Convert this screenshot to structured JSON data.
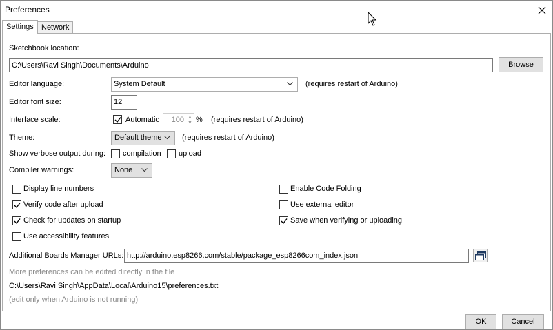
{
  "window": {
    "title": "Preferences"
  },
  "tabs": [
    {
      "label": "Settings"
    },
    {
      "label": "Network"
    }
  ],
  "sketchbook": {
    "label": "Sketchbook location:",
    "value": "C:\\Users\\Ravi Singh\\Documents\\Arduino",
    "browse_label": "Browse"
  },
  "editor_language": {
    "label": "Editor language:",
    "value": "System Default",
    "note": "(requires restart of Arduino)"
  },
  "editor_font_size": {
    "label": "Editor font size:",
    "value": "12"
  },
  "interface_scale": {
    "label": "Interface scale:",
    "automatic_label": "Automatic",
    "automatic_checked": true,
    "value": "100",
    "unit": "%",
    "note": "(requires restart of Arduino)"
  },
  "theme": {
    "label": "Theme:",
    "value": "Default theme",
    "note": "(requires restart of Arduino)"
  },
  "verbose": {
    "label": "Show verbose output during:",
    "compilation_label": "compilation",
    "compilation_checked": false,
    "upload_label": "upload",
    "upload_checked": false
  },
  "compiler_warnings": {
    "label": "Compiler warnings:",
    "value": "None"
  },
  "options": {
    "display_line_numbers": {
      "label": "Display line numbers",
      "checked": false
    },
    "verify_after_upload": {
      "label": "Verify code after upload",
      "checked": true
    },
    "check_updates": {
      "label": "Check for updates on startup",
      "checked": true
    },
    "accessibility": {
      "label": "Use accessibility features",
      "checked": false
    },
    "code_folding": {
      "label": "Enable Code Folding",
      "checked": false
    },
    "external_editor": {
      "label": "Use external editor",
      "checked": false
    },
    "save_when_verifying": {
      "label": "Save when verifying or uploading",
      "checked": true
    }
  },
  "boards_manager": {
    "label": "Additional Boards Manager URLs:",
    "value": "http://arduino.esp8266.com/stable/package_esp8266com_index.json",
    "icon": "window-icon"
  },
  "footer": {
    "more_prefs": "More preferences can be edited directly in the file",
    "prefs_path": "C:\\Users\\Ravi Singh\\AppData\\Local\\Arduino15\\preferences.txt",
    "edit_note": "(edit only when Arduino is not running)"
  },
  "buttons": {
    "ok": "OK",
    "cancel": "Cancel"
  }
}
